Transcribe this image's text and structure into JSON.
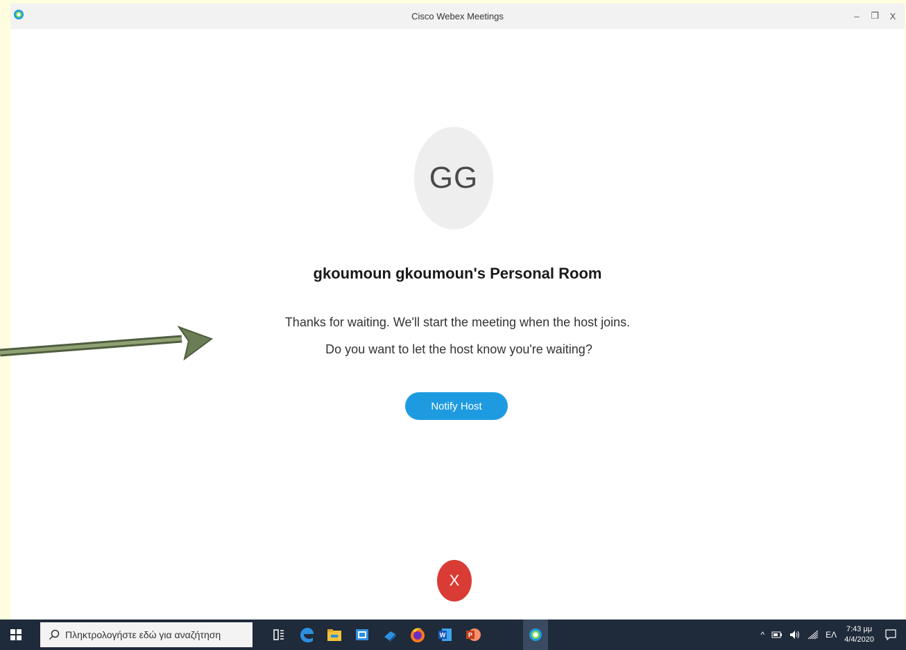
{
  "window": {
    "title": "Cisco Webex Meetings",
    "controls": {
      "minimize": "–",
      "restore": "❐",
      "close": "X"
    }
  },
  "meeting": {
    "avatar_initials": "GG",
    "room_title": "gkoumoun gkoumoun's Personal Room",
    "message_line1": "Thanks for waiting. We'll start the meeting when the host joins.",
    "message_line2": "Do you want to let the host know you're waiting?",
    "notify_button": "Notify Host",
    "leave_button": "X"
  },
  "colors": {
    "accent": "#1e9be0",
    "leave": "#d93b35",
    "arrow": "#6b7d55",
    "taskbar": "#1f2a3a",
    "page_background": "#fffde0"
  },
  "taskbar": {
    "search_placeholder": "Πληκτρολογήστε εδώ για αναζήτηση",
    "apps": [
      "task-view-icon",
      "edge-icon",
      "file-explorer-icon",
      "outlook-icon",
      "store-icon",
      "firefox-icon",
      "word-icon",
      "powerpoint-icon",
      "webex-icon"
    ],
    "tray": {
      "chevron": "^",
      "language": "ΕΛ",
      "time": "7:43 μμ",
      "date": "4/4/2020"
    }
  }
}
